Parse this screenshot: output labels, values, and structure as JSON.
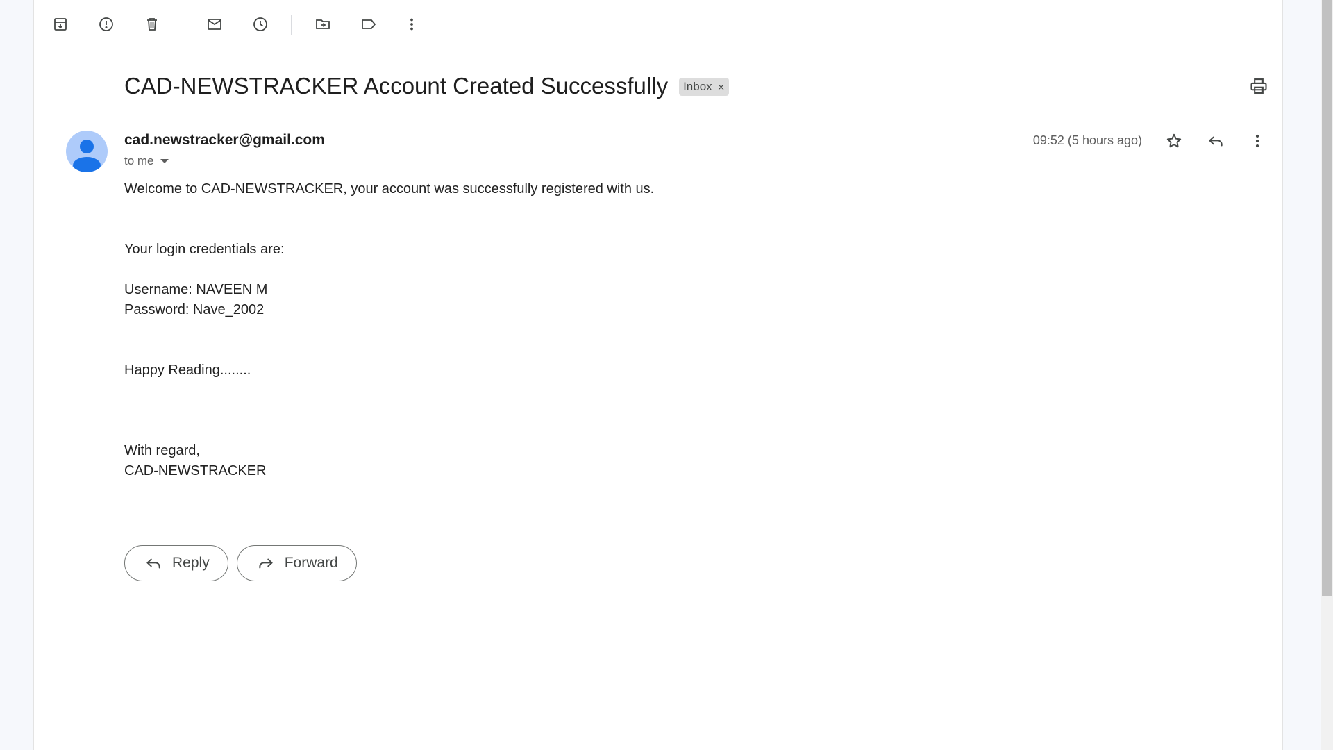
{
  "toolbar": {
    "actions": [
      {
        "name": "archive-icon",
        "label": "Archive"
      },
      {
        "name": "report-spam-icon",
        "label": "Report spam"
      },
      {
        "name": "delete-icon",
        "label": "Delete"
      },
      {
        "name": "mark-unread-icon",
        "label": "Mark as unread"
      },
      {
        "name": "snooze-icon",
        "label": "Snooze"
      },
      {
        "name": "move-to-icon",
        "label": "Move to"
      },
      {
        "name": "labels-icon",
        "label": "Labels"
      },
      {
        "name": "more-vert-icon",
        "label": "More"
      }
    ]
  },
  "email": {
    "subject": "CAD-NEWSTRACKER Account Created Successfully",
    "label": "Inbox",
    "label_remove": "×",
    "sender": "cad.newstracker@gmail.com",
    "recipient": "to me",
    "timestamp": "09:52 (5 hours ago)",
    "body": {
      "welcome": "Welcome to CAD-NEWSTRACKER, your account was successfully registered with us.",
      "credentials_intro": "Your login credentials are:",
      "username": "Username: NAVEEN M",
      "password": "Password: Nave_2002",
      "closing_line": "Happy Reading........",
      "regards": "With regard,",
      "signature": "CAD-NEWSTRACKER"
    }
  },
  "actions": {
    "reply_label": "Reply",
    "forward_label": "Forward"
  },
  "colors": {
    "avatar_bg": "#aecbfa",
    "avatar_fg": "#1a73e8",
    "label_chip_bg": "#dddddd",
    "page_bg": "#f6f8fc"
  }
}
